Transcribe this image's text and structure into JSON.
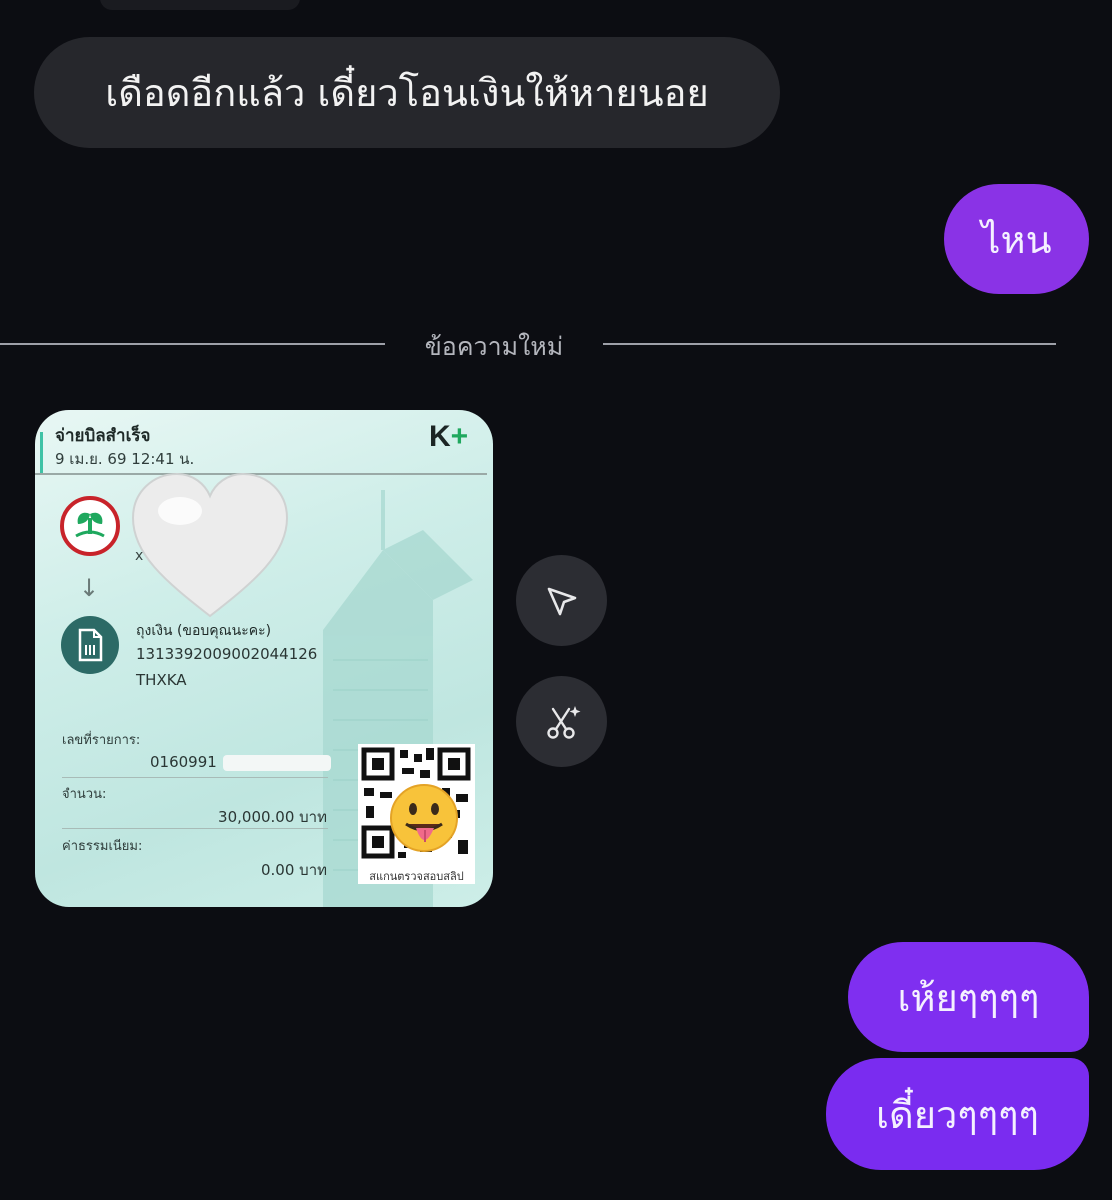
{
  "chat": {
    "incoming_message": "เดือดอีกแล้ว เดี๋ยวโอนเงินให้หายนอย",
    "outgoing_1": "ไหน",
    "divider_label": "ข้อความใหม่",
    "outgoing_2": "เห้ยๆๆๆๆ",
    "outgoing_3": "เดี๋ยวๆๆๆๆ"
  },
  "slip": {
    "title": "จ่ายบิลสำเร็จ",
    "datetime": "9 เม.ย. 69  12:41 น.",
    "brand": "K",
    "brand_plus": "+",
    "sender_masked": "x⁠",
    "arrow": "↓",
    "recipient_name": "ถุงเงิน (ขอบคุณนะคะ)",
    "recipient_account": "1313392009002044126",
    "recipient_code": "THXKA",
    "ref_label": "เลขที่รายการ:",
    "ref_value": "0160991",
    "amount_label": "จำนวน:",
    "amount_value": "30,000.00 บาท",
    "fee_label": "ค่าธรรมเนียม:",
    "fee_value": "0.00 บาท",
    "qr_caption": "สแกนตรวจสอบสลิป",
    "colors": {
      "logo_red": "#c8232a",
      "logo_green": "#1fa85e",
      "accent": "#3fc2a6"
    }
  },
  "actions": {
    "share_icon": "send-icon",
    "cut_icon": "scissors-sparkle-icon"
  },
  "colors": {
    "background": "#0c0d12",
    "incoming_bubble": "#26272c",
    "outgoing_bubble": "#7a2ff0"
  }
}
